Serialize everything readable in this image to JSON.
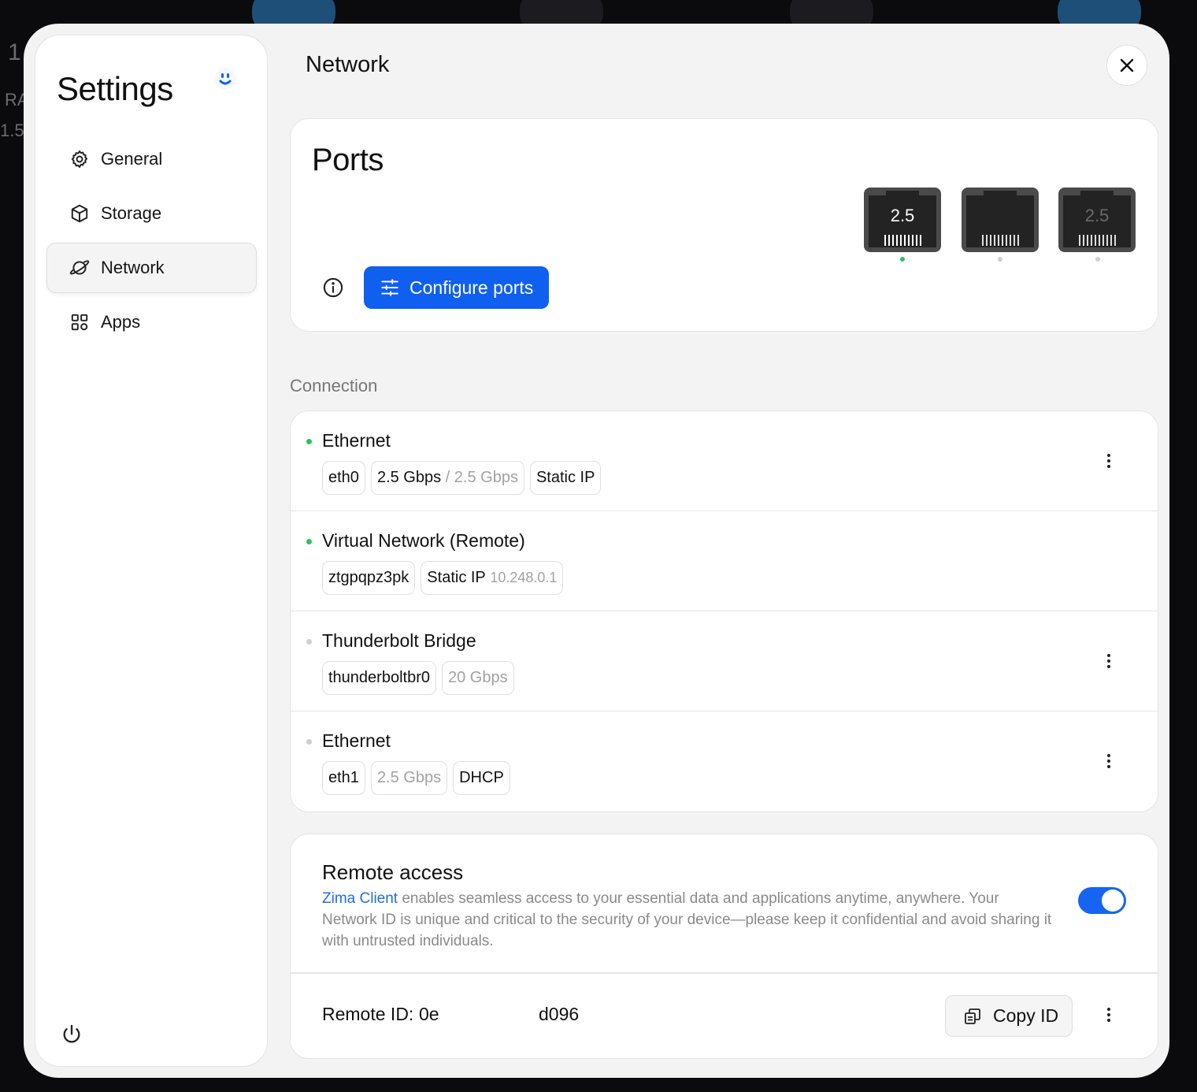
{
  "colors": {
    "accent": "#1060f0",
    "online": "#2bc25b",
    "offline": "#cfcfcf",
    "link": "#1f6fe0"
  },
  "sidebar": {
    "title": "Settings",
    "items": [
      {
        "label": "General",
        "icon": "gear-icon"
      },
      {
        "label": "Storage",
        "icon": "box-icon"
      },
      {
        "label": "Network",
        "icon": "planet-icon",
        "active": true
      },
      {
        "label": "Apps",
        "icon": "grid-icon"
      }
    ]
  },
  "header": {
    "title": "Network"
  },
  "ports": {
    "title": "Ports",
    "configure_label": "Configure ports",
    "items": [
      {
        "speed": "2.5",
        "connected": true
      },
      {
        "speed": "",
        "connected": false
      },
      {
        "speed": "2.5",
        "connected": false
      }
    ]
  },
  "connection": {
    "label": "Connection",
    "rows": [
      {
        "name": "Ethernet",
        "online": true,
        "iface": "eth0",
        "speed": "2.5 Gbps",
        "speed_sep": " / ",
        "speed_max": "2.5 Gbps",
        "mode": "Static IP"
      },
      {
        "name": "Virtual Network (Remote)",
        "online": true,
        "iface": "ztgpqpz3pk",
        "mode": "Static IP",
        "ip": "10.248.0.1"
      },
      {
        "name": "Thunderbolt Bridge",
        "online": false,
        "iface": "thunderboltbr0",
        "speed_max": "20 Gbps"
      },
      {
        "name": "Ethernet",
        "online": false,
        "iface": "eth1",
        "speed_max": "2.5 Gbps",
        "mode": "DHCP"
      }
    ]
  },
  "remote": {
    "title": "Remote access",
    "link_text": "Zima Client",
    "description": " enables seamless access to your essential data and applications anytime, anywhere. Your Network ID is unique and critical to the security of your device—please keep it confidential and avoid sharing it with untrusted individuals.",
    "enabled": true,
    "id_label": "Remote ID:",
    "id_start": "0e",
    "id_end": "d096",
    "copy_label": "Copy ID"
  },
  "background": {
    "texts": [
      "1",
      "RA",
      "1.5"
    ]
  }
}
